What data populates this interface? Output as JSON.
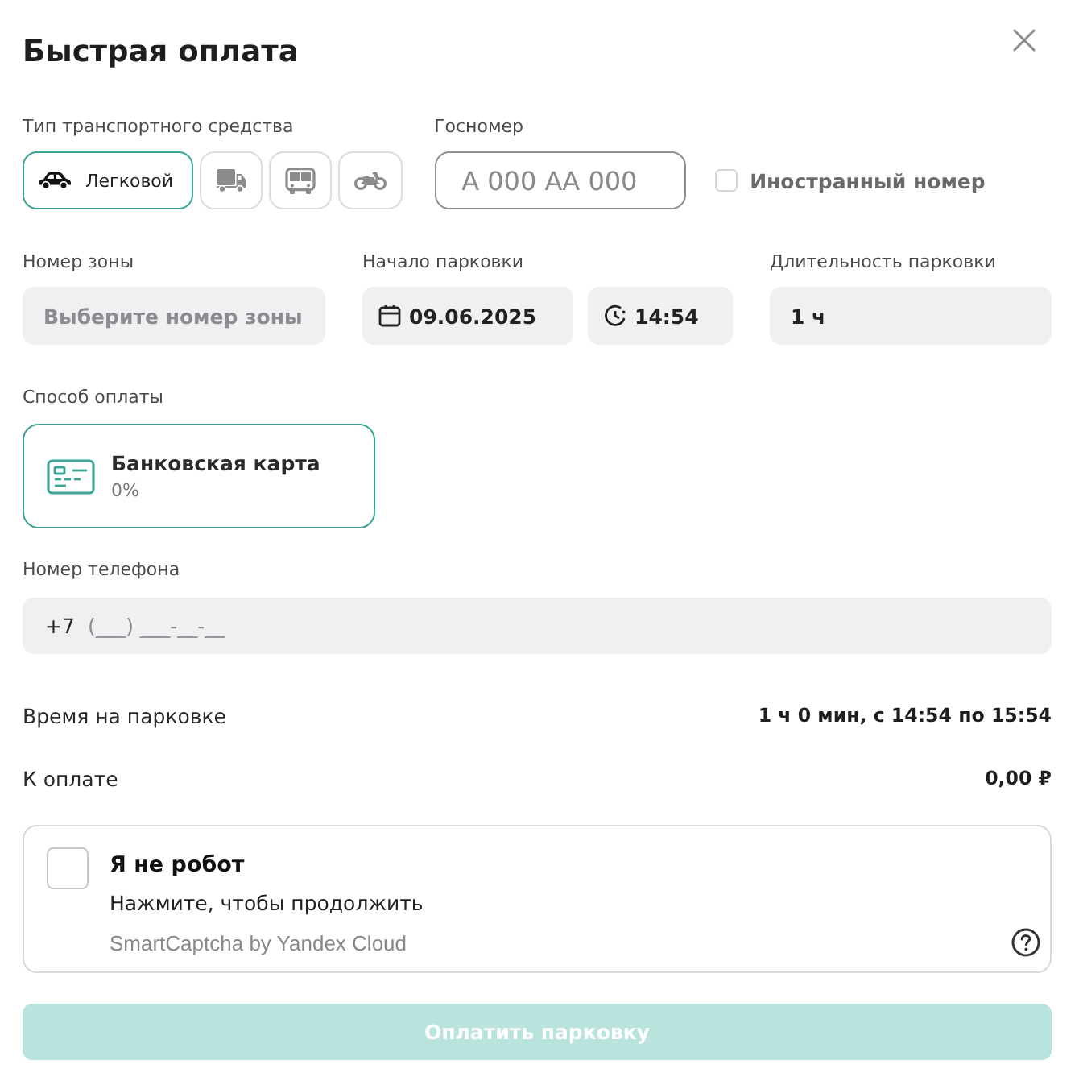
{
  "dialog": {
    "title": "Быстрая оплата"
  },
  "vehicle_type": {
    "label": "Тип транспортного средства",
    "options": [
      {
        "kind": "car",
        "label": "Легковой",
        "selected": true
      },
      {
        "kind": "truck",
        "selected": false
      },
      {
        "kind": "bus",
        "selected": false
      },
      {
        "kind": "motorcycle",
        "selected": false
      }
    ]
  },
  "plate": {
    "label": "Госномер",
    "placeholder": "А 000 АА 000",
    "foreign": {
      "label": "Иностранный номер",
      "checked": false
    }
  },
  "zone": {
    "label": "Номер зоны",
    "placeholder": "Выберите номер зоны"
  },
  "start": {
    "label": "Начало парковки",
    "date": "09.06.2025",
    "time": "14:54"
  },
  "duration": {
    "label": "Длительность парковки",
    "value": "1 ч"
  },
  "payment": {
    "label": "Способ оплаты",
    "methods": [
      {
        "kind": "card",
        "name": "Банковская карта",
        "fee": "0%",
        "selected": true
      }
    ]
  },
  "phone": {
    "label": "Номер телефона",
    "prefix": "+7",
    "placeholder": "(___) ___-__-__"
  },
  "summary": [
    {
      "label": "Время на парковке",
      "value": "1 ч 0 мин, с 14:54 по 15:54"
    },
    {
      "label": "К оплате",
      "value": "0,00 ₽"
    }
  ],
  "captcha": {
    "checked": false,
    "title": "Я не робот",
    "hint": "Нажмите, чтобы продолжить",
    "brand": "SmartCaptcha by Yandex Cloud"
  },
  "submit": {
    "label": "Оплатить парковку",
    "disabled": true
  }
}
